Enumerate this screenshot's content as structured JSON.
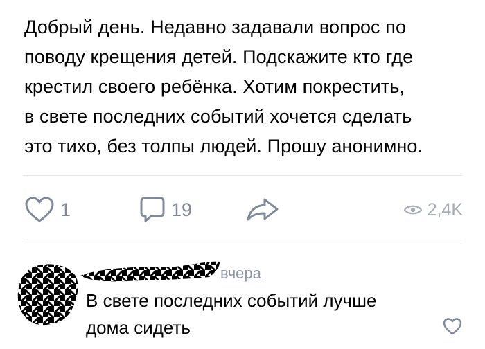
{
  "post": {
    "text": "Добрый день. Недавно задавали вопрос по\nповоду крещения детей. Подскажите кто где\nкрестил своего ребёнка. Хотим покрестить,\nв свете последних событий хочется сделать\nэто тихо, без толпы людей. Прошу анонимно."
  },
  "actions": {
    "likes": "1",
    "comments": "19",
    "views": "2,4K"
  },
  "comment": {
    "time": "вчера",
    "text": "В свете последних событий лучше\nдома сидеть"
  },
  "icons": {
    "like": "heart-icon",
    "comment": "comment-bubble-icon",
    "share": "share-arrow-icon",
    "views": "eye-icon",
    "comment_like": "heart-icon"
  },
  "colors": {
    "icon": "#7f8a99",
    "views": "#a5adb8",
    "divider": "#e3e4e8"
  }
}
